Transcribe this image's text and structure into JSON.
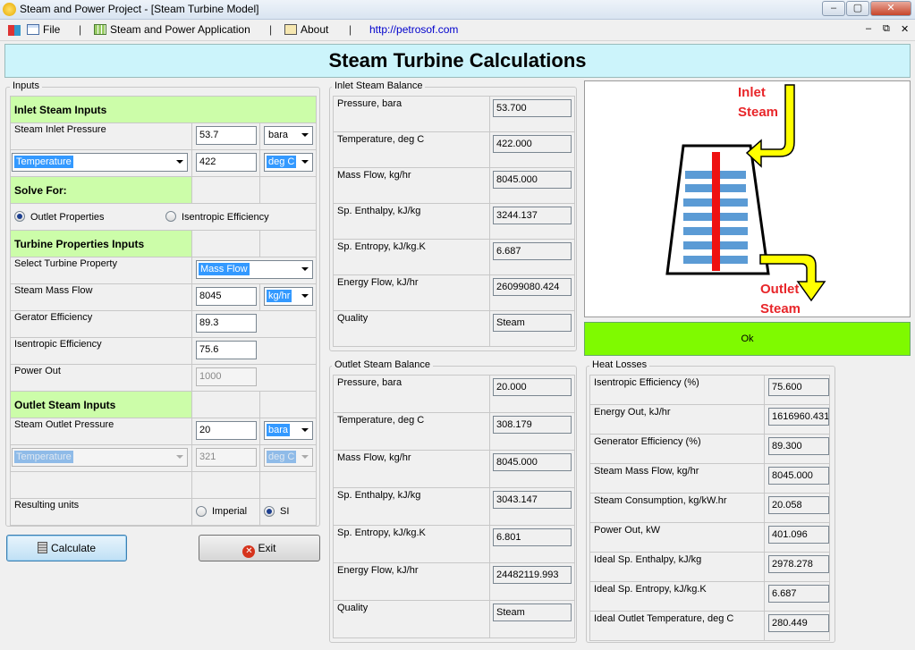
{
  "window": {
    "title": "Steam and Power Project - [Steam Turbine Model]",
    "controls": {
      "minimize": "–",
      "restore": "▢",
      "close": "✕"
    }
  },
  "menu": {
    "file": "File",
    "app": "Steam and Power Application",
    "about": "About",
    "link": "http://petrosof.com",
    "separator": "|",
    "mdi": {
      "minimize": "–",
      "restore": "⧉",
      "close": "✕"
    }
  },
  "header": {
    "title": "Steam Turbine Calculations"
  },
  "inputs": {
    "group_title": "Inputs",
    "inlet_header": "Inlet Steam Inputs",
    "inlet_pressure_label": "Steam Inlet Pressure",
    "inlet_pressure_value": "53.7",
    "inlet_pressure_unit": "bara",
    "inlet_prop_select": "Temperature",
    "inlet_prop_value": "422",
    "inlet_prop_unit": "deg C",
    "solve_header": "Solve For:",
    "solve_outlet": "Outlet Properties",
    "solve_isen": "Isentropic Efficiency",
    "turbine_header": "Turbine Properties Inputs",
    "select_prop_label": "Select Turbine Property",
    "select_prop_value": "Mass Flow",
    "mass_flow_label": "Steam Mass Flow",
    "mass_flow_value": "8045",
    "mass_flow_unit": "kg/hr",
    "gen_eff_label": "Gerator Efficiency",
    "gen_eff_value": "89.3",
    "isen_eff_label": "Isentropic Efficiency",
    "isen_eff_value": "75.6",
    "power_label": "Power Out",
    "power_value": "1000",
    "outlet_header": "Outlet Steam Inputs",
    "outlet_pressure_label": "Steam Outlet Pressure",
    "outlet_pressure_value": "20",
    "outlet_pressure_unit": "bara",
    "outlet_prop_select": "Temperature",
    "outlet_prop_value": "321",
    "outlet_prop_unit": "deg C",
    "units_label": "Resulting units",
    "units_imperial": "Imperial",
    "units_si": "SI"
  },
  "buttons": {
    "calculate": "Calculate",
    "exit": "Exit",
    "ok": "Ok"
  },
  "inlet_balance": {
    "title": "Inlet Steam Balance",
    "rows": [
      {
        "label": "Pressure, bara",
        "value": "53.700"
      },
      {
        "label": "Temperature, deg C",
        "value": "422.000"
      },
      {
        "label": "Mass Flow, kg/hr",
        "value": "8045.000"
      },
      {
        "label": "Sp. Enthalpy, kJ/kg",
        "value": "3244.137"
      },
      {
        "label": "Sp. Entropy, kJ/kg.K",
        "value": "6.687"
      },
      {
        "label": "Energy Flow, kJ/hr",
        "value": "26099080.424"
      },
      {
        "label": "Quality",
        "value": "Steam"
      }
    ]
  },
  "outlet_balance": {
    "title": "Outlet Steam Balance",
    "rows": [
      {
        "label": "Pressure, bara",
        "value": "20.000"
      },
      {
        "label": "Temperature, deg C",
        "value": "308.179"
      },
      {
        "label": "Mass Flow, kg/hr",
        "value": "8045.000"
      },
      {
        "label": "Sp. Enthalpy, kJ/kg",
        "value": "3043.147"
      },
      {
        "label": "Sp. Entropy, kJ/kg.K",
        "value": "6.801"
      },
      {
        "label": "Energy Flow, kJ/hr",
        "value": "24482119.993"
      },
      {
        "label": "Quality",
        "value": "Steam"
      }
    ]
  },
  "heat_losses": {
    "title": "Heat Losses",
    "rows": [
      {
        "label": "Isentropic Efficiency (%)",
        "value": "75.600"
      },
      {
        "label": "Energy Out, kJ/hr",
        "value": "1616960.431"
      },
      {
        "label": "Generator Efficiency (%)",
        "value": "89.300"
      },
      {
        "label": "Steam Mass Flow, kg/hr",
        "value": "8045.000"
      },
      {
        "label": "Steam Consumption, kg/kW.hr",
        "value": "20.058"
      },
      {
        "label": "Power Out, kW",
        "value": "401.096"
      },
      {
        "label": "Ideal Sp. Enthalpy, kJ/kg",
        "value": "2978.278"
      },
      {
        "label": "Ideal Sp. Entropy, kJ/kg.K",
        "value": "6.687"
      },
      {
        "label": "Ideal Outlet Temperature, deg C",
        "value": "280.449"
      }
    ]
  },
  "diagram": {
    "inlet_line1": "Inlet",
    "inlet_line2": "Steam",
    "outlet_line1": "Outlet",
    "outlet_line2": "Steam"
  },
  "colors": {
    "header_bg": "#ccf4fb",
    "section_green": "#ccfda9",
    "ok_button": "#7ffa00",
    "selection": "#3399ff",
    "diagram_red": "#ee1111",
    "diagram_yellow": "#ffff00",
    "diagram_blue": "#5b9bd5"
  }
}
